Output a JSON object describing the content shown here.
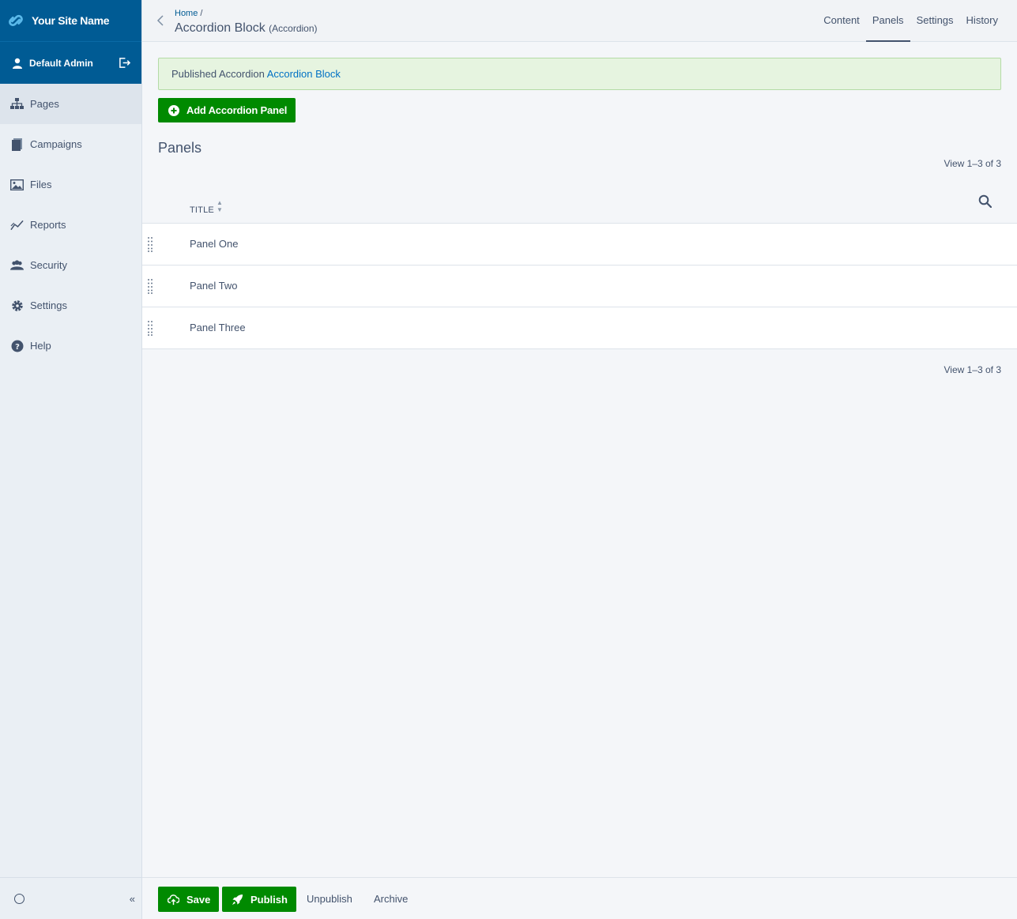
{
  "brand": {
    "site_name": "Your Site Name"
  },
  "user": {
    "name": "Default Admin"
  },
  "nav": [
    {
      "label": "Pages",
      "icon": "sitemap-icon",
      "active": true
    },
    {
      "label": "Campaigns",
      "icon": "campaigns-icon"
    },
    {
      "label": "Files",
      "icon": "image-icon"
    },
    {
      "label": "Reports",
      "icon": "chart-line-icon"
    },
    {
      "label": "Security",
      "icon": "users-icon"
    },
    {
      "label": "Settings",
      "icon": "gear-icon"
    },
    {
      "label": "Help",
      "icon": "question-icon"
    }
  ],
  "sidebar_footer": {
    "collapse_label": "«"
  },
  "header": {
    "breadcrumb": "Home",
    "breadcrumb_sep": " /",
    "title": "Accordion Block",
    "title_type": "(Accordion)",
    "tabs": [
      "Content",
      "Panels",
      "Settings",
      "History"
    ],
    "active_tab": "Panels"
  },
  "alert": {
    "prefix": "Published Accordion ",
    "link": "Accordion Block"
  },
  "add_button": {
    "label": "Add Accordion Panel"
  },
  "panels": {
    "heading": "Panels",
    "count_top": "View 1–3 of 3",
    "count_bottom": "View 1–3 of 3",
    "column_title": "TITLE",
    "rows": [
      "Panel One",
      "Panel Two",
      "Panel Three"
    ]
  },
  "actions": {
    "save": "Save",
    "publish": "Publish",
    "unpublish": "Unpublish",
    "archive": "Archive"
  },
  "colors": {
    "brand_blue": "#005b94",
    "primary_green": "#008a00",
    "link_blue": "#0071c4",
    "text": "#43536d"
  }
}
